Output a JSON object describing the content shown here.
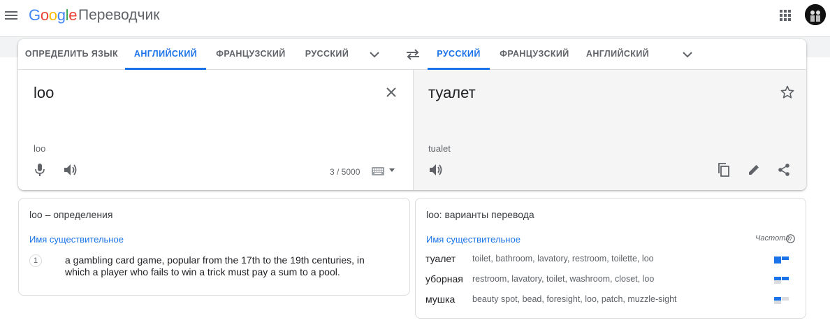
{
  "header": {
    "logo_letters": [
      "G",
      "o",
      "o",
      "g",
      "l",
      "e"
    ],
    "app_name": "Переводчик"
  },
  "source_tabs": [
    {
      "label": "ОПРЕДЕЛИТЬ ЯЗЫК",
      "active": false
    },
    {
      "label": "АНГЛИЙСКИЙ",
      "active": true
    },
    {
      "label": "ФРАНЦУЗСКИЙ",
      "active": false
    },
    {
      "label": "РУССКИЙ",
      "active": false
    }
  ],
  "target_tabs": [
    {
      "label": "РУССКИЙ",
      "active": true
    },
    {
      "label": "ФРАНЦУЗСКИЙ",
      "active": false
    },
    {
      "label": "АНГЛИЙСКИЙ",
      "active": false
    }
  ],
  "source": {
    "text": "loo",
    "transliteration": "loo",
    "char_count": "3 / 5000"
  },
  "target": {
    "text": "туалет",
    "transliteration": "tualet"
  },
  "definitions": {
    "title": "loo – определения",
    "part_of_speech": "Имя существительное",
    "items": [
      {
        "num": "1",
        "text": "a gambling card game, popular from the 17th to the 19th centuries, in which a player who fails to win a trick must pay a sum to a pool."
      }
    ]
  },
  "translations": {
    "title": "loo: варианты перевода",
    "part_of_speech": "Имя существительное",
    "frequency_label": "Частота",
    "rows": [
      {
        "word": "туалет",
        "synonyms": "toilet, bathroom, lavatory, restroom, toilette, loo",
        "frequency": 3
      },
      {
        "word": "уборная",
        "synonyms": "restroom, lavatory, toilet, washroom, closet, loo",
        "frequency": 2
      },
      {
        "word": "мушка",
        "synonyms": "beauty spot, bead, foresight, loo, patch, muzzle-sight",
        "frequency": 1
      }
    ]
  },
  "colors": {
    "accent": "#1a73e8",
    "target_bg": "#f5f5f5"
  }
}
